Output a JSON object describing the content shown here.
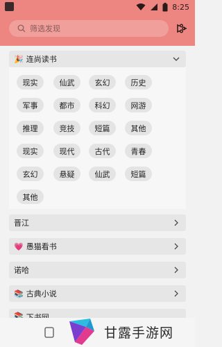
{
  "status": {
    "time": "8:25"
  },
  "search": {
    "placeholder": "筛选发现"
  },
  "sections": {
    "lianshang": {
      "emoji": "🎉",
      "label": "连尚读书"
    },
    "jinjiang": {
      "label": "晋江"
    },
    "yumao": {
      "emoji": "💗",
      "label": "愚猫看书"
    },
    "nuoha": {
      "label": "诺哈"
    },
    "gudian": {
      "emoji": "📚",
      "label": "古典小说"
    },
    "xiashu": {
      "emoji": "📚",
      "label": "下书网"
    }
  },
  "tags": [
    [
      "现实",
      "仙武",
      "玄幻",
      "历史"
    ],
    [
      "军事",
      "都市",
      "科幻",
      "网游"
    ],
    [
      "推理",
      "竞技",
      "短篇",
      "其他"
    ],
    [
      "现实",
      "现代",
      "古代",
      "青春"
    ],
    [
      "玄幻",
      "悬疑",
      "仙武",
      "短篇"
    ],
    [
      "其他"
    ]
  ],
  "watermark": {
    "text": "甘露手游网"
  },
  "icons": {
    "search": "search-icon",
    "filter": "filter-icon",
    "chevron_down": "chevron-down-icon",
    "chevron_right": "chevron-right-icon"
  },
  "colors": {
    "header": "#ed8580",
    "tag": "#e4e4e4",
    "section": "#e6e6e6"
  }
}
